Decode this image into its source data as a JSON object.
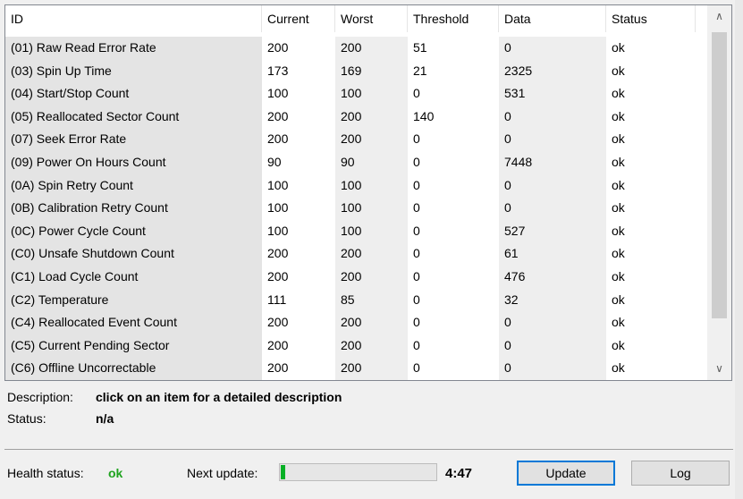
{
  "table": {
    "columns": [
      "ID",
      "Current",
      "Worst",
      "Threshold",
      "Data",
      "Status"
    ],
    "rows": [
      [
        "(01) Raw Read Error Rate",
        "200",
        "200",
        "51",
        "0",
        "ok"
      ],
      [
        "(03) Spin Up Time",
        "173",
        "169",
        "21",
        "2325",
        "ok"
      ],
      [
        "(04) Start/Stop Count",
        "100",
        "100",
        "0",
        "531",
        "ok"
      ],
      [
        "(05) Reallocated Sector Count",
        "200",
        "200",
        "140",
        "0",
        "ok"
      ],
      [
        "(07) Seek Error Rate",
        "200",
        "200",
        "0",
        "0",
        "ok"
      ],
      [
        "(09) Power On Hours Count",
        "90",
        "90",
        "0",
        "7448",
        "ok"
      ],
      [
        "(0A) Spin Retry Count",
        "100",
        "100",
        "0",
        "0",
        "ok"
      ],
      [
        "(0B) Calibration Retry Count",
        "100",
        "100",
        "0",
        "0",
        "ok"
      ],
      [
        "(0C) Power Cycle Count",
        "100",
        "100",
        "0",
        "527",
        "ok"
      ],
      [
        "(C0) Unsafe Shutdown Count",
        "200",
        "200",
        "0",
        "61",
        "ok"
      ],
      [
        "(C1) Load Cycle Count",
        "200",
        "200",
        "0",
        "476",
        "ok"
      ],
      [
        "(C2) Temperature",
        "111",
        "85",
        "0",
        "32",
        "ok"
      ],
      [
        "(C4) Reallocated Event Count",
        "200",
        "200",
        "0",
        "0",
        "ok"
      ],
      [
        "(C5) Current Pending Sector",
        "200",
        "200",
        "0",
        "0",
        "ok"
      ],
      [
        "(C6) Offline Uncorrectable",
        "200",
        "200",
        "0",
        "0",
        "ok"
      ]
    ]
  },
  "scrollbar": {
    "up_icon": "chevron-up-icon",
    "down_icon": "chevron-down-icon"
  },
  "description": {
    "label": "Description:",
    "value": "click on an item for a detailed description",
    "status_label": "Status:",
    "status_value": "n/a"
  },
  "footer": {
    "health_label": "Health status:",
    "health_value": "ok",
    "health_color": "#1fa31f",
    "next_update_label": "Next update:",
    "progress": 0.03,
    "progress_color": "#06b025",
    "countdown": "4:47",
    "update_button": "Update",
    "log_button": "Log"
  }
}
